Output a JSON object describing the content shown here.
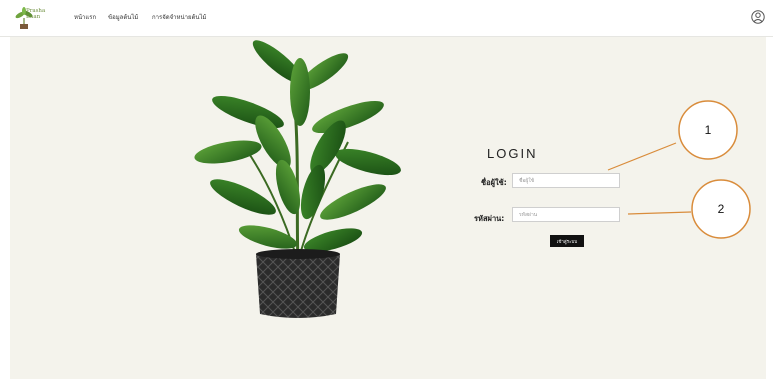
{
  "header": {
    "logo_text": "Prasha\nBaan",
    "nav": [
      "หน้าแรก",
      "ข้อมูลต้นไม้",
      "การจัดจำหน่ายต้นไม้"
    ],
    "user_icon": "user-circle-icon"
  },
  "login": {
    "title": "LOGIN",
    "username_label": "ชื่อผู้ใช้:",
    "username_placeholder": "ชื่อผู้ใช้",
    "password_label": "รหัสผ่าน:",
    "password_placeholder": "รหัสผ่าน",
    "submit_label": "เข้าสู่ระบบ"
  },
  "annotations": [
    "1",
    "2"
  ],
  "colors": {
    "background": "#f4f3ec",
    "callout_circle": "#d98c3b",
    "button": "#111111"
  }
}
